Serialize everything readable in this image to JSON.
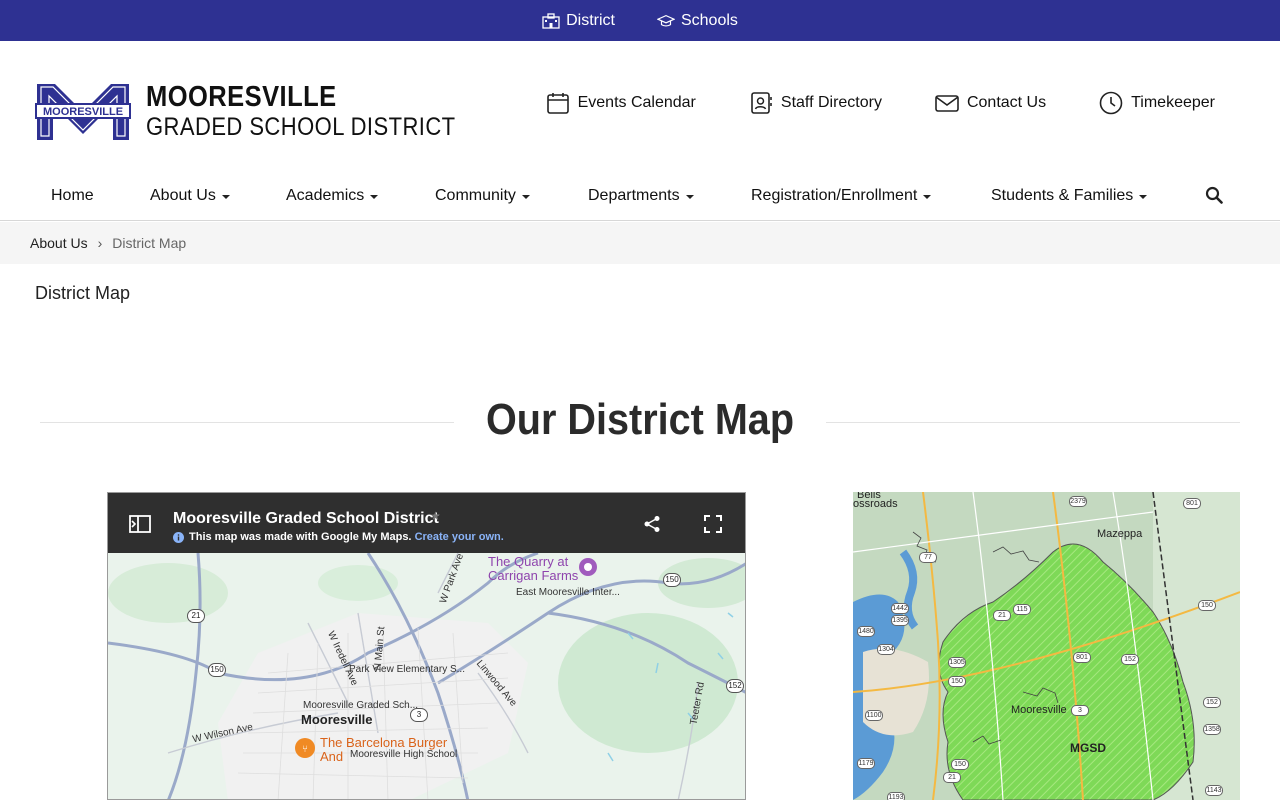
{
  "topbar": {
    "district": "District",
    "schools": "Schools"
  },
  "logo": {
    "line1": "MOORESVILLE",
    "line2": "GRADED SCHOOL DISTRICT",
    "emblem_text": "MOORESVILLE"
  },
  "quicklinks": [
    {
      "label": "Events Calendar",
      "icon": "calendar-icon"
    },
    {
      "label": "Staff Directory",
      "icon": "contact-card-icon"
    },
    {
      "label": "Contact Us",
      "icon": "envelope-icon"
    },
    {
      "label": "Timekeeper",
      "icon": "clock-icon"
    }
  ],
  "nav": {
    "items": [
      "Home",
      "About Us",
      "Academics",
      "Community",
      "Departments",
      "Registration/Enrollment",
      "Students & Families"
    ]
  },
  "breadcrumb": {
    "parent": "About Us",
    "current": "District Map"
  },
  "page_title": "District Map",
  "section_title": "Our District Map",
  "gmap": {
    "title": "Mooresville Graded School District",
    "note": "This map was made with Google My Maps.",
    "note_link": "Create your own.",
    "labels": {
      "quarry": "The Quarry at",
      "quarry2": "Carrigan Farms",
      "east": "East Mooresville Inter...",
      "park_view": "Park View Elementary S...",
      "mgsd": "Mooresville Graded Sch...",
      "mooresville": "Mooresville",
      "barcelona1": "The Barcelona Burger",
      "barcelona2": "And ",
      "high_school": "Mooresville High School",
      "w_wilson": "W Wilson Ave",
      "w_park": "W Park Ave",
      "iredell": "W Iredell Ave",
      "main": "N Main St",
      "linwood": "Linwood Ave",
      "teeter": "Teeter Rd"
    },
    "shields": {
      "s21": "21",
      "s150a": "150",
      "s150b": "150",
      "s152": "152",
      "s3": "3"
    }
  },
  "dmap": {
    "labels": {
      "bells": "Bells",
      "crossroads": "ossroads",
      "mazeppa": "Mazeppa",
      "mooresville": "Mooresville",
      "mgsd": "MGSD"
    },
    "shields": [
      "2379",
      "801",
      "1442",
      "1395",
      "115",
      "1480",
      "1304",
      "21",
      "1305",
      "150",
      "801",
      "152",
      "150",
      "1100",
      "3",
      "1358",
      "152",
      "1179",
      "1143",
      "1193",
      "21",
      "150",
      "77"
    ]
  },
  "colors": {
    "topbar": "#2e3192",
    "district_fill": "#7ed957",
    "link": "#8ab4f8"
  }
}
